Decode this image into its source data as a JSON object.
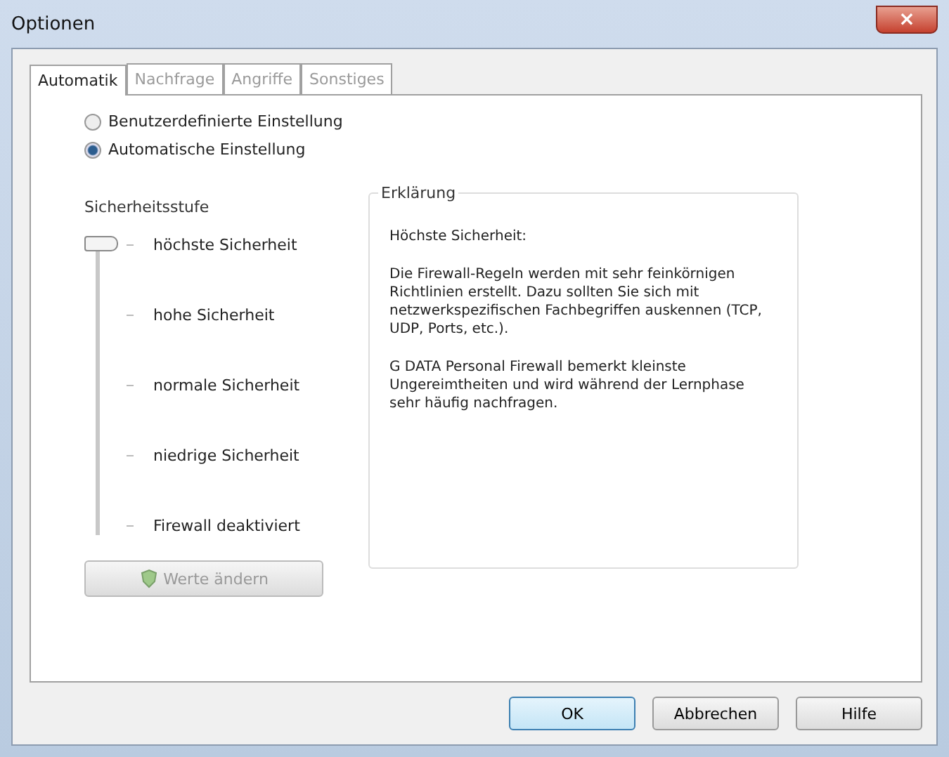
{
  "window": {
    "title": "Optionen",
    "close": "×"
  },
  "tabs": [
    {
      "label": "Automatik",
      "selected": true,
      "disabled": false
    },
    {
      "label": "Nachfrage",
      "selected": false,
      "disabled": true
    },
    {
      "label": "Angriffe",
      "selected": false,
      "disabled": true
    },
    {
      "label": "Sonstiges",
      "selected": false,
      "disabled": true
    }
  ],
  "modes": [
    {
      "label": "Benutzerdefinierte Einstellung",
      "selected": false
    },
    {
      "label": "Automatische Einstellung",
      "selected": true
    }
  ],
  "security": {
    "title": "Sicherheitsstufe",
    "level": 1,
    "steps": [
      "höchste Sicherheit",
      "hohe Sicherheit",
      "normale Sicherheit",
      "niedrige Sicherheit",
      "Firewall deaktiviert"
    ],
    "change_button": {
      "label": "Werte ändern",
      "disabled": true
    }
  },
  "explanation": {
    "title": "Erklärung",
    "paragraphs": [
      "Höchste Sicherheit:",
      "Die Firewall-Regeln werden mit sehr feinkörnigen Richtlinien  erstellt. Dazu sollten Sie sich mit netzwerkspezifischen Fachbegriffen auskennen (TCP, UDP, Ports, etc.).",
      "G DATA Personal Firewall bemerkt kleinste Ungereimtheiten und wird während der Lernphase sehr häufig nachfragen."
    ]
  },
  "buttons": [
    {
      "label": "OK",
      "default": true
    },
    {
      "label": "Abbrechen",
      "default": false
    },
    {
      "label": "Hilfe",
      "default": false
    }
  ]
}
